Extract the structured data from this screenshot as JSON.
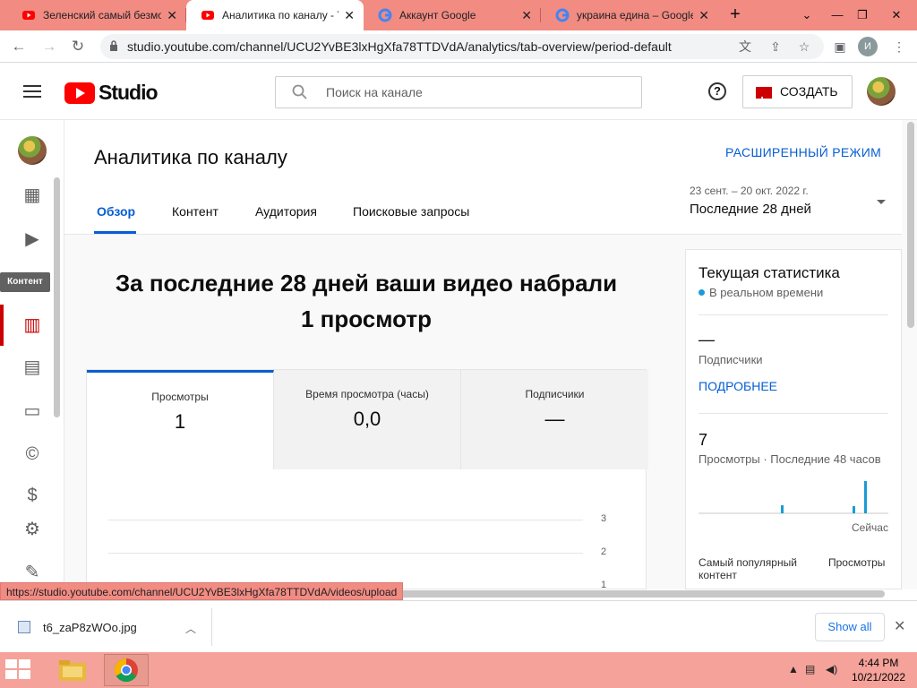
{
  "browser": {
    "tabs": [
      {
        "title": "Зеленский самый безмо",
        "active": false
      },
      {
        "title": "Аналитика по каналу - Y",
        "active": true
      },
      {
        "title": "Аккаунт Google",
        "active": false
      },
      {
        "title": "украина едина – Google",
        "active": false
      }
    ],
    "url": "studio.youtube.com/channel/UCU2YvBE3lxHgXfa78TTDVdA/analytics/tab-overview/period-default",
    "profile_initial": "И"
  },
  "header": {
    "logo_text": "Studio",
    "search_placeholder": "Поиск на канале",
    "create_label": "СОЗДАТЬ"
  },
  "sidebar": {
    "tooltip": "Контент"
  },
  "page": {
    "title": "Аналитика по каналу",
    "advanced_mode": "РАСШИРЕННЫЙ РЕЖИМ",
    "tabs": [
      "Обзор",
      "Контент",
      "Аудитория",
      "Поисковые запросы"
    ],
    "date_range": "23 сент. – 20 окт. 2022 г.",
    "period": "Последние 28 дней",
    "headline_line1": "За последние 28 дней ваши видео набрали",
    "headline_line2": "1 просмотр"
  },
  "metrics": [
    {
      "label": "Просмотры",
      "value": "1"
    },
    {
      "label": "Время просмотра (часы)",
      "value": "0,0"
    },
    {
      "label": "Подписчики",
      "value": "—"
    }
  ],
  "chart_ticks": [
    "3",
    "2",
    "1"
  ],
  "realtime": {
    "title": "Текущая статистика",
    "subtitle": "В реальном времени",
    "subs_value": "—",
    "subs_label": "Подписчики",
    "more_link": "ПОДРОБНЕЕ",
    "views_value": "7",
    "views_label": "Просмотры · Последние 48 часов",
    "now_label": "Сейчас",
    "popular_label": "Самый популярный контент",
    "popular_col": "Просмотры",
    "accent": "#1a9bd8"
  },
  "status_url": "https://studio.youtube.com/channel/UCU2YvBE3lxHgXfa78TTDVdA/videos/upload",
  "downloads": {
    "file": "t6_zaP8zWOo.jpg",
    "show_all": "Show all"
  },
  "taskbar": {
    "time": "4:44 PM",
    "date": "10/21/2022"
  }
}
